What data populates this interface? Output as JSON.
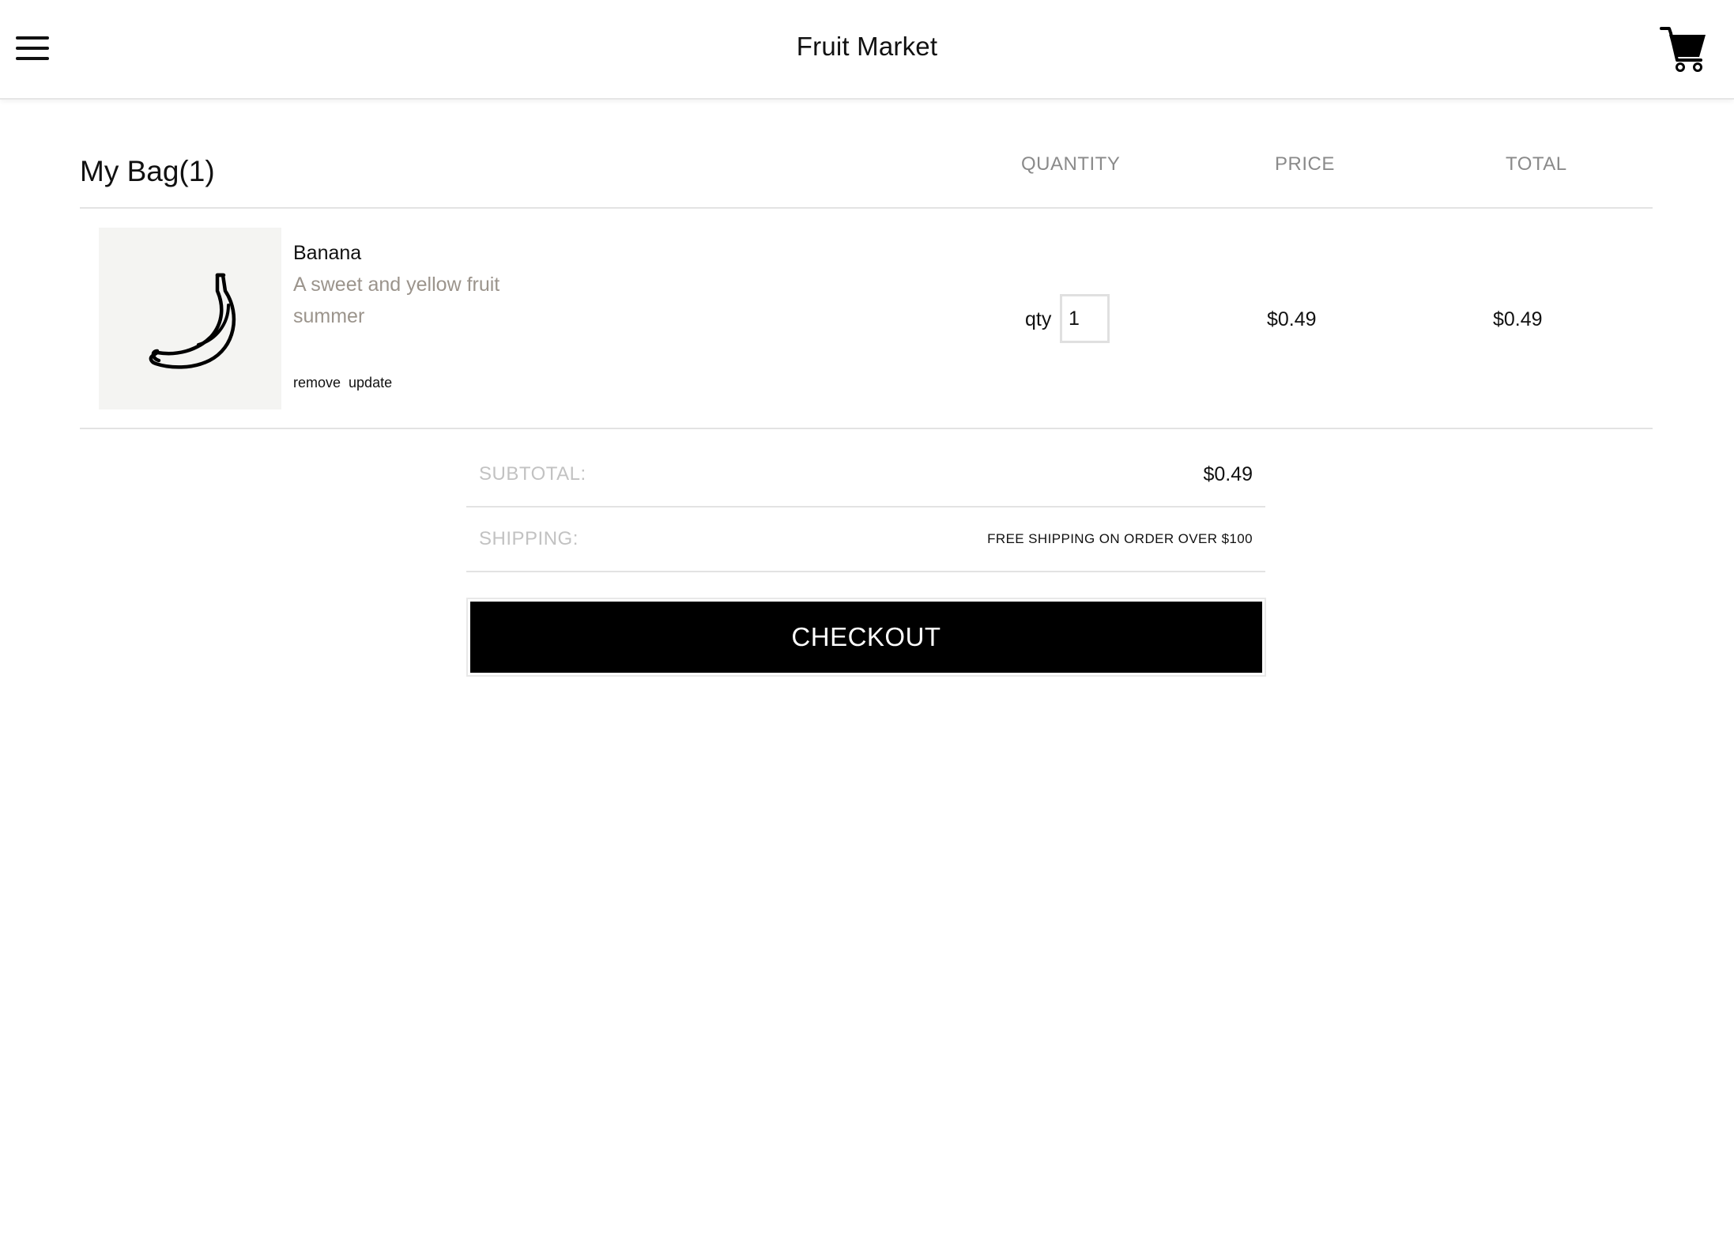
{
  "header": {
    "title": "Fruit Market",
    "menu_icon": "hamburger-menu-icon",
    "cart_icon": "shopping-cart-icon"
  },
  "bag": {
    "title": "My Bag(1)",
    "columns": {
      "quantity": "QUANTITY",
      "price": "PRICE",
      "total": "TOTAL"
    },
    "items": [
      {
        "name": "Banana",
        "description": "A sweet and yellow fruit",
        "season": "summer",
        "image_icon": "banana-icon",
        "remove_label": "remove",
        "update_label": "update",
        "qty_label": "qty",
        "quantity": "1",
        "price": "$0.49",
        "total": "$0.49"
      }
    ]
  },
  "summary": {
    "subtotal_label": "SUBTOTAL:",
    "subtotal_value": "$0.49",
    "shipping_label": "SHIPPING:",
    "shipping_note": "FREE SHIPPING ON ORDER OVER $100"
  },
  "checkout": {
    "label": "CHECKOUT"
  }
}
